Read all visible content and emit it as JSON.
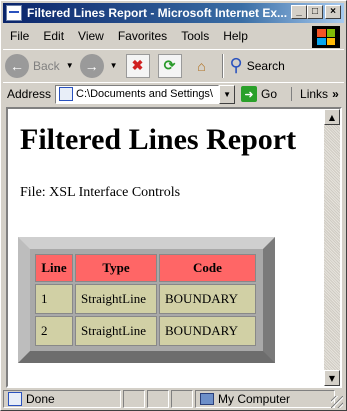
{
  "window": {
    "title": "Filtered Lines Report - Microsoft Internet Ex...",
    "min_glyph": "_",
    "max_glyph": "□",
    "close_glyph": "×"
  },
  "menu": {
    "items": [
      "File",
      "Edit",
      "View",
      "Favorites",
      "Tools",
      "Help"
    ]
  },
  "toolbar": {
    "back_label": "Back",
    "search_label": "Search",
    "back_glyph": "←",
    "forward_glyph": "→",
    "stop_glyph": "✖",
    "refresh_glyph": "⟳",
    "home_glyph": "⌂",
    "search_glyph": "⚲"
  },
  "addressbar": {
    "label": "Address",
    "value": "C:\\Documents and Settings\\",
    "go_label": "Go",
    "links_label": "Links",
    "chevron": "»"
  },
  "page": {
    "title": "Filtered Lines Report",
    "file_line": "File: XSL Interface Controls",
    "table": {
      "headers": [
        "Line",
        "Type",
        "Code"
      ],
      "rows": [
        [
          "1",
          "StraightLine",
          "BOUNDARY"
        ],
        [
          "2",
          "StraightLine",
          "BOUNDARY"
        ]
      ]
    }
  },
  "status": {
    "left_text": "Done",
    "zone_text": "My Computer"
  },
  "colors": {
    "title_bar": "#0a246a",
    "table_header": "#ff6666",
    "table_cell": "#d1d0a5"
  }
}
